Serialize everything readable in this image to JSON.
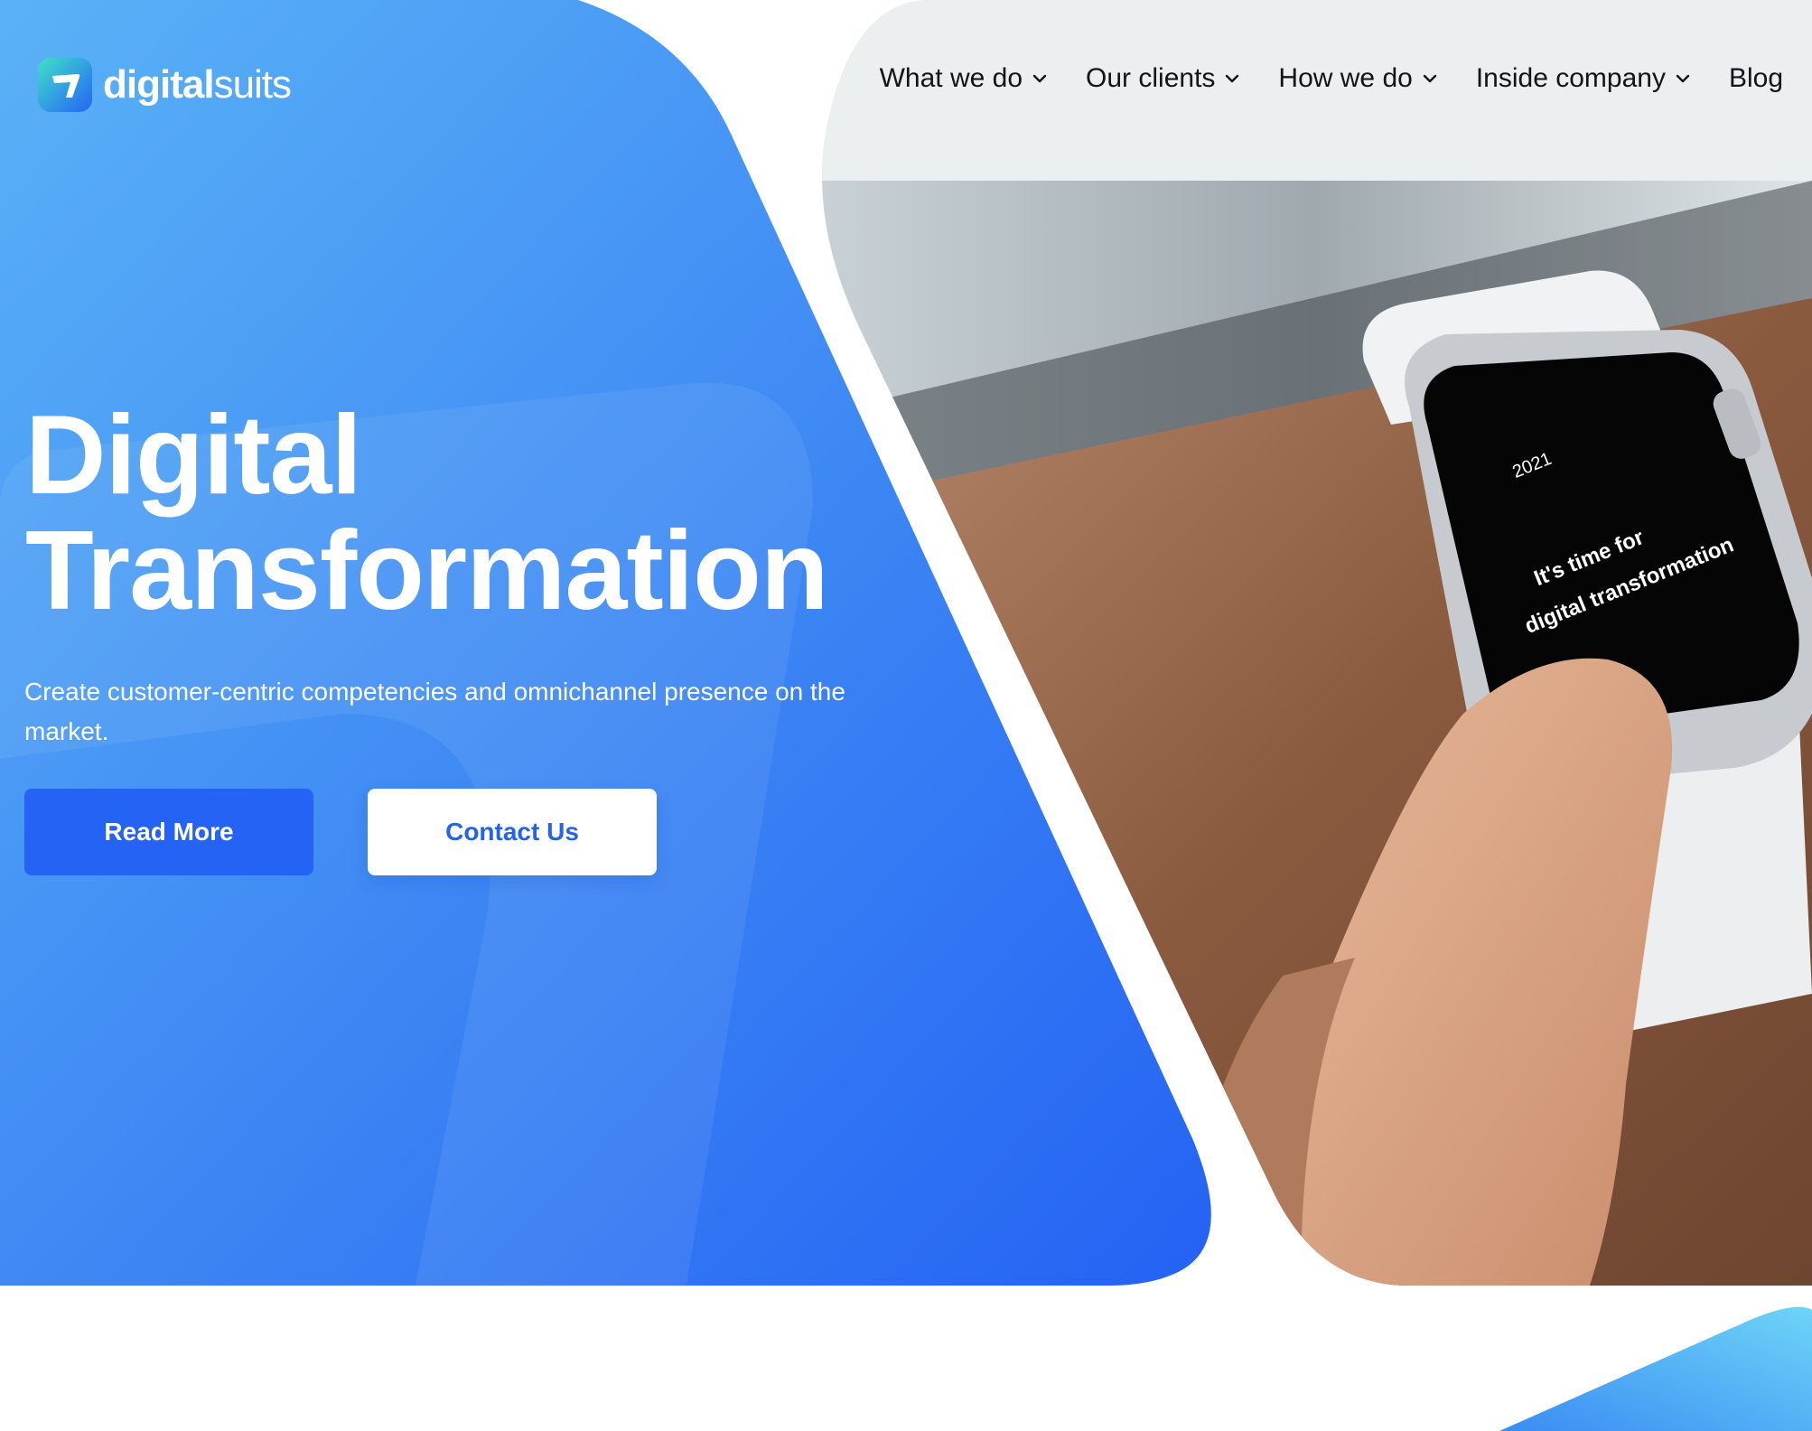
{
  "brand": {
    "name_bold": "digital",
    "name_light": "suits",
    "logo_icon": "digitalsuits-logo-icon"
  },
  "nav": {
    "items": [
      {
        "label": "What we do",
        "has_dropdown": true
      },
      {
        "label": "Our clients",
        "has_dropdown": true
      },
      {
        "label": "How we do",
        "has_dropdown": true
      },
      {
        "label": "Inside company",
        "has_dropdown": true
      },
      {
        "label": "Blog",
        "has_dropdown": false
      }
    ]
  },
  "hero": {
    "title_line1": "Digital",
    "title_line2": "Transformation",
    "subtitle": "Create customer-centric competencies and omnichannel presence on the market.",
    "read_more_label": "Read More",
    "contact_label": "Contact Us"
  },
  "watch_screen": {
    "year": "2021",
    "line1": "It's time for",
    "line2": "digital transformation"
  },
  "colors": {
    "hero_gradient_start": "#5ab0f5",
    "hero_gradient_end": "#2563f5",
    "primary_button": "#2563f5",
    "accent_text": "#2563eb"
  }
}
